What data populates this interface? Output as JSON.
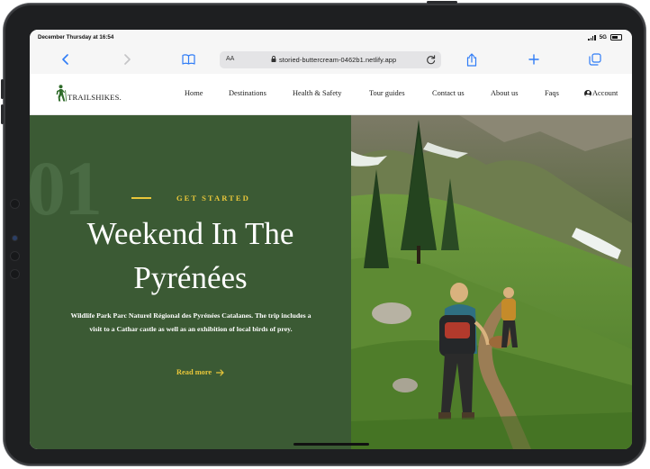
{
  "status_bar": {
    "time": "December Thursday at 16:54",
    "network": "5G"
  },
  "browser": {
    "text_size_label": "AA",
    "url": "storied-buttercream-0462b1.netlify.app",
    "icons": [
      "back-icon",
      "forward-icon",
      "bookmarks-icon",
      "lock-icon",
      "reload-icon",
      "share-icon",
      "new-tab-icon",
      "tabs-icon"
    ]
  },
  "site": {
    "logo": "TRAILSHIKES.",
    "nav": {
      "home": "Home",
      "destinations": "Destinations",
      "health": "Health & Safety",
      "guides": "Tour guides",
      "contact": "Contact us",
      "about": "About us",
      "faqs": "Faqs",
      "account": "Account"
    }
  },
  "hero": {
    "number": "01",
    "eyebrow": "GET STARTED",
    "title_line1": "Weekend In The",
    "title_line2": "Pyrénées",
    "description": "Wildlife Park Parc Naturel Régional des Pyrénées Catalanes. The trip includes a visit to a Cathar castle as well as an exhibition of local birds of prey.",
    "cta": "Read more",
    "colors": {
      "panel": "#3b5a34",
      "accent": "#e8c63a"
    }
  }
}
